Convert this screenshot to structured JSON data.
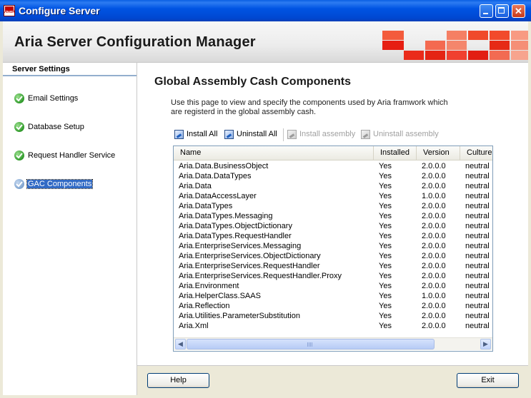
{
  "window": {
    "title": "Configure Server",
    "app_icon_text": "ARIA"
  },
  "header": {
    "title": "Aria Server Configuration Manager"
  },
  "sidebar": {
    "heading": "Server Settings",
    "items": [
      {
        "label": "Email Settings",
        "status": "complete"
      },
      {
        "label": "Database Setup",
        "status": "complete"
      },
      {
        "label": "Request Handler Service",
        "status": "complete"
      },
      {
        "label": "GAC Components",
        "status": "selected"
      }
    ]
  },
  "main": {
    "title": "Global Assembly Cash Components",
    "description": "Use this page to view and specify the components used by Aria framwork which are registerd in the global assembly cash.",
    "toolbar": {
      "install_all": "Install All",
      "uninstall_all": "Uninstall All",
      "install_assembly": "Install assembly",
      "uninstall_assembly": "Uninstall assembly"
    },
    "table": {
      "columns": [
        "Name",
        "Installed",
        "Version",
        "Culture"
      ],
      "rows": [
        [
          "Aria.Data.BusinessObject",
          "Yes",
          "2.0.0.0",
          "neutral"
        ],
        [
          "Aria.Data.DataTypes",
          "Yes",
          "2.0.0.0",
          "neutral"
        ],
        [
          "Aria.Data",
          "Yes",
          "2.0.0.0",
          "neutral"
        ],
        [
          "Aria.DataAccessLayer",
          "Yes",
          "1.0.0.0",
          "neutral"
        ],
        [
          "Aria.DataTypes",
          "Yes",
          "2.0.0.0",
          "neutral"
        ],
        [
          "Aria.DataTypes.Messaging",
          "Yes",
          "2.0.0.0",
          "neutral"
        ],
        [
          "Aria.DataTypes.ObjectDictionary",
          "Yes",
          "2.0.0.0",
          "neutral"
        ],
        [
          "Aria.DataTypes.RequestHandler",
          "Yes",
          "2.0.0.0",
          "neutral"
        ],
        [
          "Aria.EnterpriseServices.Messaging",
          "Yes",
          "2.0.0.0",
          "neutral"
        ],
        [
          "Aria.EnterpriseServices.ObjectDictionary",
          "Yes",
          "2.0.0.0",
          "neutral"
        ],
        [
          "Aria.EnterpriseServices.RequestHandler",
          "Yes",
          "2.0.0.0",
          "neutral"
        ],
        [
          "Aria.EnterpriseServices.RequestHandler.Proxy",
          "Yes",
          "2.0.0.0",
          "neutral"
        ],
        [
          "Aria.Environment",
          "Yes",
          "2.0.0.0",
          "neutral"
        ],
        [
          "Aria.HelperClass.SAAS",
          "Yes",
          "1.0.0.0",
          "neutral"
        ],
        [
          "Aria.Reflection",
          "Yes",
          "2.0.0.0",
          "neutral"
        ],
        [
          "Aria.Utilities.ParameterSubstitution",
          "Yes",
          "2.0.0.0",
          "neutral"
        ],
        [
          "Aria.Xml",
          "Yes",
          "2.0.0.0",
          "neutral"
        ]
      ]
    }
  },
  "footer": {
    "help_label": "Help",
    "exit_label": "Exit"
  },
  "colors": {
    "titlebar": "#0054e3",
    "accent_red": "#e21e12",
    "selection": "#316ac5",
    "check_green": "#2f9a2a"
  }
}
